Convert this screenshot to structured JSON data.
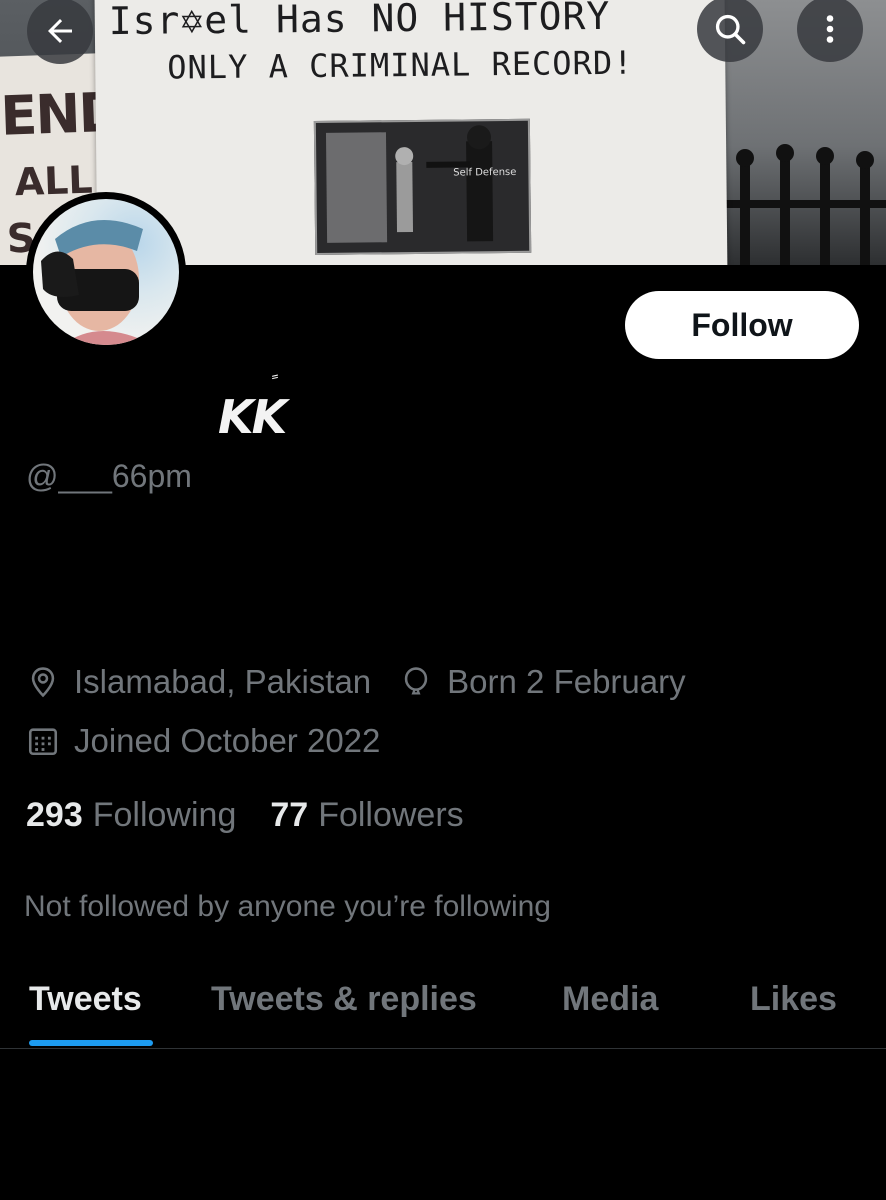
{
  "banner": {
    "sign_line1": "Isr✡el Has NO HISTORY",
    "sign_line2": "ONLY A CRIMINAL RECORD!",
    "cartoon_label": "Self Defense",
    "left_sign_line1": "END",
    "left_sign_line2": "ALL",
    "left_sign_line3": "S"
  },
  "header": {
    "back_icon": "arrow-left-icon",
    "search_icon": "search-icon",
    "more_icon": "more-vertical-icon"
  },
  "profile": {
    "follow_label": "Follow",
    "display_name": "KK",
    "display_name_mark": "ً",
    "handle": "@___66pm",
    "location": "Islamabad, Pakistan",
    "birthday": "Born 2 February",
    "joined": "Joined October 2022",
    "following_count": "293",
    "following_label": "Following",
    "followers_count": "77",
    "followers_label": "Followers",
    "not_followed_text": "Not followed by anyone you’re following"
  },
  "tabs": [
    {
      "label": "Tweets",
      "active": true
    },
    {
      "label": "Tweets & replies",
      "active": false
    },
    {
      "label": "Media",
      "active": false
    },
    {
      "label": "Likes",
      "active": false
    }
  ],
  "colors": {
    "background": "#000000",
    "text_primary": "#e7e9ea",
    "text_secondary": "#71767b",
    "accent": "#1d9bf0",
    "follow_bg": "#ffffff"
  }
}
